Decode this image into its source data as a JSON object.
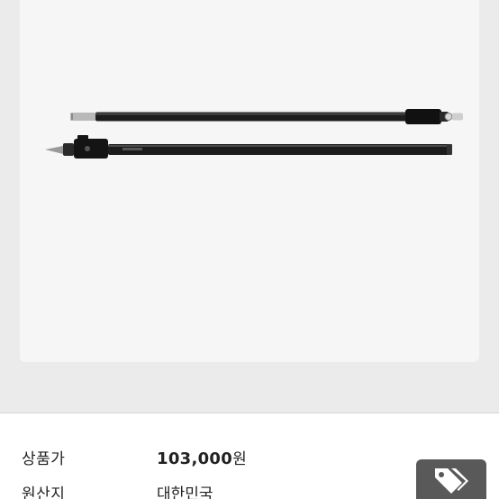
{
  "product": {
    "image_alt": "Black aluminum tarp pole in two sections",
    "price_label": "상품가",
    "price_value": "103,000",
    "price_unit": "원",
    "origin_label": "원산지",
    "origin_value": "대한민국"
  },
  "actions": {
    "coupon_icon": "tags-icon"
  },
  "colors": {
    "background": "#ebebeb",
    "card": "#f6f6f6",
    "button": "#595959"
  }
}
